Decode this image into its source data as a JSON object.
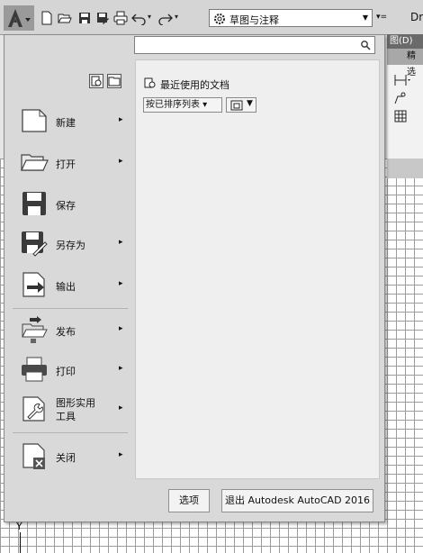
{
  "qat": {
    "workspace": "草图与注释",
    "app_title": "Dr"
  },
  "background": {
    "menu_draw": "图(D)",
    "tab_featured": "精选"
  },
  "search": {
    "placeholder": ""
  },
  "commands": [
    {
      "label": "新建",
      "has_arrow": true
    },
    {
      "label": "打开",
      "has_arrow": true
    },
    {
      "label": "保存",
      "has_arrow": false
    },
    {
      "label": "另存为",
      "has_arrow": true
    },
    {
      "label": "输出",
      "has_arrow": true
    },
    {
      "label": "发布",
      "has_arrow": true
    },
    {
      "label": "打印",
      "has_arrow": true
    },
    {
      "label_line1": "图形实用",
      "label_line2": "工具",
      "has_arrow": true
    },
    {
      "label": "关闭",
      "has_arrow": true
    }
  ],
  "arrow_glyph": "▸",
  "recent": {
    "title": "最近使用的文档",
    "sort_label": "按已排序列表 ▾"
  },
  "bottom": {
    "options_label": "选项",
    "exit_label": "退出 Autodesk AutoCAD 2016"
  },
  "ucs_axis": "Y"
}
